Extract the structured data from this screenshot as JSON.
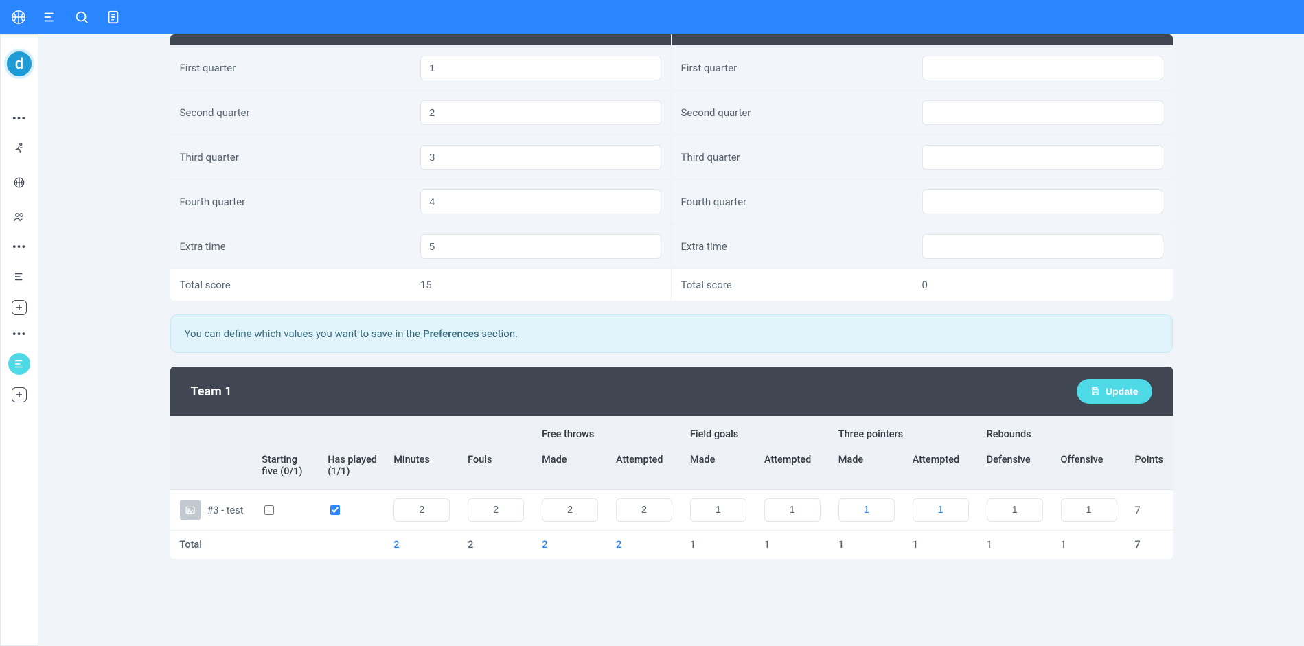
{
  "topbar": {
    "icons": [
      "basketball-icon",
      "bars-icon",
      "search-icon",
      "doc-icon"
    ]
  },
  "sidebar": {
    "avatar_letter": "d"
  },
  "score": {
    "rows": [
      {
        "label": "First quarter",
        "val_left": "1",
        "val_right": ""
      },
      {
        "label": "Second quarter",
        "val_left": "2",
        "val_right": ""
      },
      {
        "label": "Third quarter",
        "val_left": "3",
        "val_right": ""
      },
      {
        "label": "Fourth quarter",
        "val_left": "4",
        "val_right": ""
      },
      {
        "label": "Extra time",
        "val_left": "5",
        "val_right": ""
      }
    ],
    "total_label": "Total score",
    "total_left": "15",
    "total_right": "0"
  },
  "banner": {
    "prefix": "You can define which values you want to save in the ",
    "link": "Preferences",
    "suffix": " section."
  },
  "team": {
    "title": "Team 1",
    "update_label": "Update",
    "group_headers": {
      "free_throws": "Free throws",
      "field_goals": "Field goals",
      "three_pointers": "Three pointers",
      "rebounds": "Rebounds"
    },
    "col_headers": {
      "player": "",
      "starting_five": "Starting five (0/1)",
      "has_played": "Has played (1/1)",
      "minutes": "Minutes",
      "fouls": "Fouls",
      "ft_made": "Made",
      "ft_att": "Attempted",
      "fg_made": "Made",
      "fg_att": "Attempted",
      "tp_made": "Made",
      "tp_att": "Attempted",
      "reb_def": "Defensive",
      "reb_off": "Offensive",
      "points": "Points"
    },
    "row": {
      "player": "#3 - test",
      "starting_five_checked": false,
      "has_played_checked": true,
      "minutes": "2",
      "fouls": "2",
      "ft_made": "2",
      "ft_att": "2",
      "fg_made": "1",
      "fg_att": "1",
      "tp_made": "1",
      "tp_att": "1",
      "reb_def": "1",
      "reb_off": "1",
      "points": "7"
    },
    "total": {
      "label": "Total",
      "minutes": "2",
      "fouls": "2",
      "ft_made": "2",
      "ft_att": "2",
      "fg_made": "1",
      "fg_att": "1",
      "tp_made": "1",
      "tp_att": "1",
      "reb_def": "1",
      "reb_off": "1",
      "points": "7"
    }
  }
}
